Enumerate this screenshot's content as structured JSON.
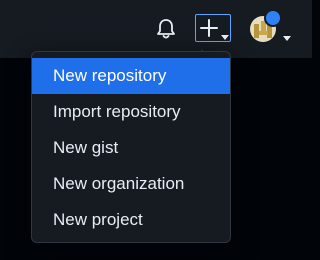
{
  "header": {
    "notifications_icon": "bell-icon",
    "create_icon": "plus-icon",
    "create_caret_icon": "chevron-down-icon",
    "avatar_icon": "user-avatar",
    "notification_dot_color": "#2f81f7"
  },
  "create_menu": {
    "items": [
      {
        "label": "New repository",
        "selected": true
      },
      {
        "label": "Import repository",
        "selected": false
      },
      {
        "label": "New gist",
        "selected": false
      },
      {
        "label": "New organization",
        "selected": false
      },
      {
        "label": "New project",
        "selected": false
      }
    ],
    "highlight_color": "#1f6feb"
  }
}
